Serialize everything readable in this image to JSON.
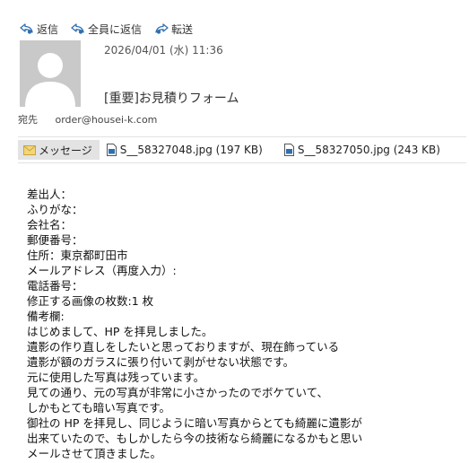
{
  "actions": [
    {
      "label": "返信",
      "icon": "reply-icon"
    },
    {
      "label": "全員に返信",
      "icon": "reply-all-icon"
    },
    {
      "label": "転送",
      "icon": "forward-icon"
    }
  ],
  "header": {
    "date": "2026/04/01 (水) 11:36",
    "subject": "[重要]お見積りフォーム",
    "recipient_label": "宛先",
    "recipient": "order@housei-k.com"
  },
  "tabs": {
    "message_label": "メッセージ"
  },
  "attachments": [
    {
      "name": "S__58327048.jpg (197 KB)"
    },
    {
      "name": "S__58327050.jpg (243 KB)"
    }
  ],
  "body_lines": [
    "差出人：",
    "ふりがな：",
    "会社名：",
    "郵便番号：",
    "住所：東京都町田市",
    "メールアドレス（再度入力）:",
    "電話番号：",
    "修正する画像の枚数:1 枚",
    "備考欄:",
    "はじめまして、HP を拝見しました。",
    "遺影の作り直しをしたいと思っておりますが、現在飾っている",
    "遺影が額のガラスに張り付いて剥がせない状態です。",
    "元に使用した写真は残っています。",
    "見ての通り、元の写真が非常に小さかったのでボケていて、",
    "しかもとても暗い写真です。",
    "御社の HP を拝見し、同じように暗い写真からとても綺麗に遺影が",
    "出来ていたので、もしかしたら今の技術なら綺麗になるかもと思い",
    "メールさせて頂きました。"
  ],
  "colors": {
    "icon_blue": "#2f6fb0",
    "avatar_bg": "#c9c9c9",
    "tab_bg": "#e3e3e3"
  }
}
